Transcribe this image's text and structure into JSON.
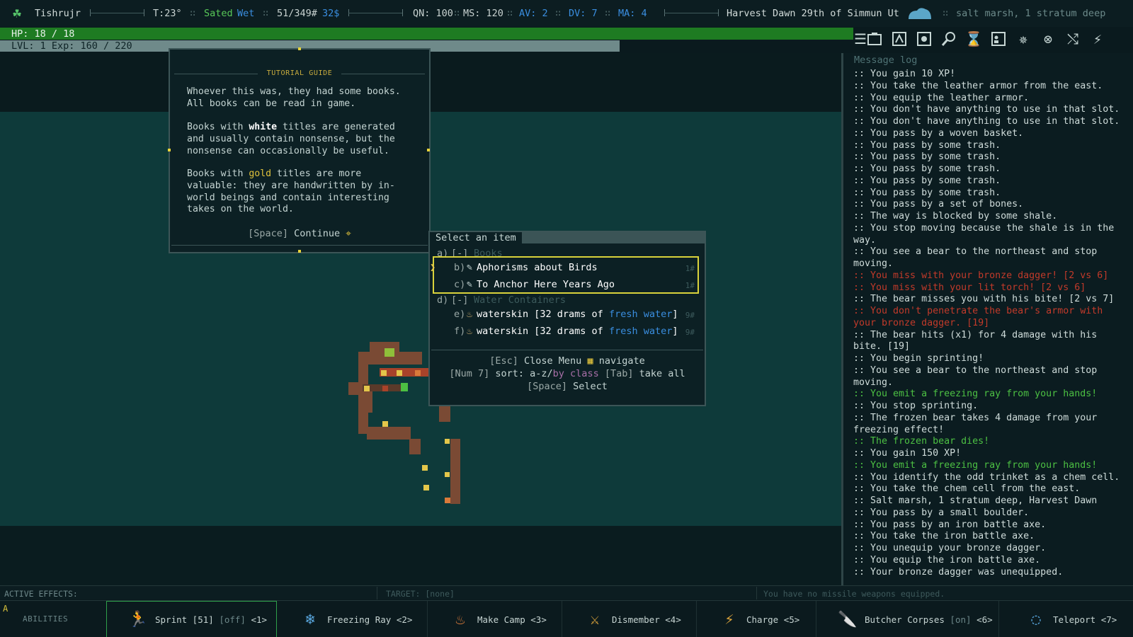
{
  "status": {
    "name": "Tishrujr",
    "temp": "T:23°",
    "hunger": "Sated",
    "wet": "Wet",
    "weight": "51/349#",
    "money": "32$",
    "qn": "QN: 100",
    "ms": "MS: 120",
    "av": "AV: 2",
    "dv": "DV: 7",
    "ma": "MA: 4",
    "date": "Harvest Dawn 29th of Simmun Ut",
    "location": "salt marsh, 1 stratum deep",
    "hp": "HP: 18 / 18",
    "hp_fraction": 1.0,
    "level": "LVL: 1 Exp: 160 / 220",
    "xp_fraction": 0.727
  },
  "toolbar_icons": [
    "menu-icon",
    "inventory-icon",
    "character-icon",
    "equipment-icon",
    "look-icon",
    "wait-icon",
    "skills-icon",
    "quests-icon",
    "journal-icon",
    "factions-icon",
    "abilities-icon"
  ],
  "tutorial": {
    "title": "TUTORIAL GUIDE",
    "para1": "Whoever this was, they had some books.\nAll books can be read in game.",
    "para2_a": "Books with ",
    "para2_white": "white",
    "para2_b": " titles are generated\nand usually contain nonsense, but the\nnonsense can occasionally be useful.",
    "para3_a": "Books with ",
    "para3_gold": "gold",
    "para3_b": " titles are more\nvaluable: they are handwritten by in-\nworld beings and contain interesting\ntakes on the world.",
    "continue_key": "[Space]",
    "continue_label": "Continue"
  },
  "picker": {
    "title": "Select an item",
    "groups": [
      {
        "key": "a)",
        "toggle": "[-]",
        "label": "Books"
      },
      {
        "key": "d)",
        "toggle": "[-]",
        "label": "Water Containers"
      }
    ],
    "items": [
      {
        "key": "b)",
        "name": "Aphorisms about Birds",
        "weight": "1#"
      },
      {
        "key": "c)",
        "name": "To Anchor Here Years Ago",
        "weight": "1#"
      },
      {
        "key": "e)",
        "name_a": "waterskin [32 drams of ",
        "name_b": "fresh water",
        "name_c": "]",
        "weight": "9#"
      },
      {
        "key": "f)",
        "name_a": "waterskin [32 drams of ",
        "name_b": "fresh water",
        "name_c": "]",
        "weight": "9#"
      }
    ],
    "help1_key": "[Esc]",
    "help1_label": "Close Menu",
    "help1_nav": "navigate",
    "help2_key": "[Num 7]",
    "help2_label": "sort: a-z/",
    "help2_class": "by class",
    "help2_tab": "[Tab]",
    "help2_take": "take all",
    "help3_key": "[Space]",
    "help3_label": "Select"
  },
  "log": {
    "title": "Message log",
    "lines": [
      {
        "t": ":: You gain 10 XP!",
        "c": ""
      },
      {
        "t": ":: You take the leather armor from the east.",
        "c": ""
      },
      {
        "t": ":: You equip the leather armor.",
        "c": ""
      },
      {
        "t": ":: You don't have anything to use in that slot.",
        "c": ""
      },
      {
        "t": ":: You don't have anything to use in that slot.",
        "c": ""
      },
      {
        "t": ":: You pass by a woven basket.",
        "c": ""
      },
      {
        "t": ":: You pass by some trash.",
        "c": ""
      },
      {
        "t": ":: You pass by some trash.",
        "c": ""
      },
      {
        "t": ":: You pass by some trash.",
        "c": ""
      },
      {
        "t": ":: You pass by some trash.",
        "c": ""
      },
      {
        "t": ":: You pass by some trash.",
        "c": ""
      },
      {
        "t": ":: You pass by a set of bones.",
        "c": ""
      },
      {
        "t": ":: The way is blocked by some shale.",
        "c": ""
      },
      {
        "t": ":: You stop moving because the shale is in the way.",
        "c": ""
      },
      {
        "t": ":: You see a bear to the northeast and stop moving.",
        "c": ""
      },
      {
        "t": ":: You miss with your bronze dagger! [2 vs 6]",
        "c": "red"
      },
      {
        "t": ":: You miss with your lit torch! [2 vs 6]",
        "c": "red"
      },
      {
        "t": ":: The bear misses you with his bite! [2 vs 7]",
        "c": ""
      },
      {
        "t": ":: You don't penetrate the bear's armor with your bronze dagger. [19]",
        "c": "red"
      },
      {
        "t": ":: The bear hits (x1) for 4 damage with his bite. [19]",
        "c": ""
      },
      {
        "t": ":: You begin sprinting!",
        "c": ""
      },
      {
        "t": ":: You see a bear to the northeast and stop moving.",
        "c": ""
      },
      {
        "t": ":: You emit a freezing ray from your hands!",
        "c": "green"
      },
      {
        "t": ":: You stop sprinting.",
        "c": ""
      },
      {
        "t": ":: The frozen bear takes 4 damage from your freezing effect!",
        "c": ""
      },
      {
        "t": ":: The frozen bear dies!",
        "c": "green"
      },
      {
        "t": ":: You gain 150 XP!",
        "c": ""
      },
      {
        "t": ":: You emit a freezing ray from your hands!",
        "c": "green"
      },
      {
        "t": ":: You identify the odd trinket as a chem cell.",
        "c": ""
      },
      {
        "t": ":: You take the chem cell from the east.",
        "c": ""
      },
      {
        "t": ":: Salt marsh, 1 stratum deep, Harvest Dawn",
        "c": ""
      },
      {
        "t": ":: You pass by a small boulder.",
        "c": ""
      },
      {
        "t": ":: You pass by an iron battle axe.",
        "c": ""
      },
      {
        "t": ":: You take the iron battle axe.",
        "c": ""
      },
      {
        "t": ":: You unequip your bronze dagger.",
        "c": ""
      },
      {
        "t": ":: You equip the iron battle axe.",
        "c": ""
      },
      {
        "t": ":: Your bronze dagger was unequipped.",
        "c": ""
      }
    ]
  },
  "effects": {
    "active_label": "ACTIVE EFFECTS:",
    "target_label": "TARGET: [none]",
    "missile_label": "You have no missile weapons equipped."
  },
  "abilities": {
    "hotkey": "A",
    "label": "ABILITIES",
    "items": [
      {
        "icon": "sprint-icon",
        "name": "Sprint [51]",
        "state": "[off]",
        "key": "<1>"
      },
      {
        "icon": "freezing-ray-icon",
        "name": "Freezing Ray",
        "state": "",
        "key": "<2>"
      },
      {
        "icon": "make-camp-icon",
        "name": "Make Camp",
        "state": "",
        "key": "<3>"
      },
      {
        "icon": "dismember-icon",
        "name": "Dismember",
        "state": "",
        "key": "<4>"
      },
      {
        "icon": "charge-icon",
        "name": "Charge",
        "state": "",
        "key": "<5>"
      },
      {
        "icon": "butcher-corpses-icon",
        "name": "Butcher Corpses",
        "state": "[on]",
        "key": "<6>"
      },
      {
        "icon": "teleport-icon",
        "name": "Teleport",
        "state": "",
        "key": "<7>"
      }
    ]
  },
  "colors": {
    "hp_bar": "#1e7b22",
    "xp_bar": "#6f8a8a",
    "select_border": "#d9d23b",
    "water": "#0e3a3a",
    "rock": "#7a4a34"
  }
}
